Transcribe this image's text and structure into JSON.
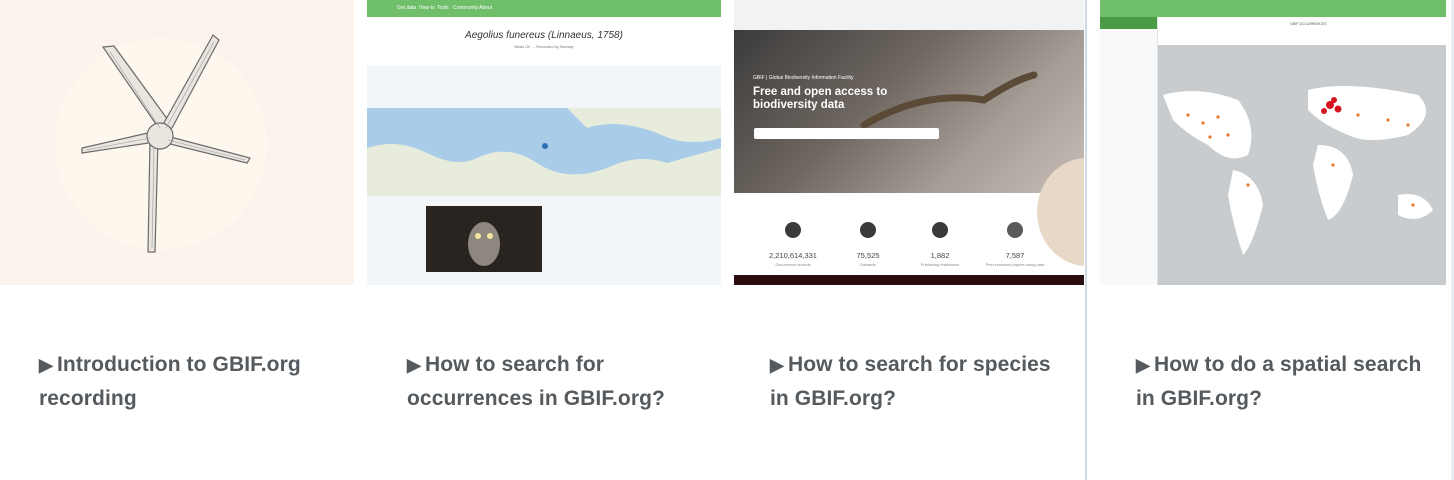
{
  "cards": [
    {
      "title": "Introduction to GBIF.org recording",
      "icon": "play-icon"
    },
    {
      "title": "How to search for occurrences in GBIF.org?",
      "icon": "play-icon"
    },
    {
      "title": "How to search for species in GBIF.org?",
      "icon": "play-icon"
    },
    {
      "title": "How to do a spatial search in GBIF.org?",
      "icon": "play-icon"
    }
  ],
  "thumb2": {
    "nav": [
      "Get data",
      "How-to",
      "Tools",
      "Community",
      "About"
    ],
    "species": "Aegolius funereus (Linnaeus, 1758)",
    "lines": [
      "Basis Of: ... Recorded by Norway"
    ]
  },
  "thumb3": {
    "hero_small": "GBIF | Global Biodiversity Information Facility",
    "hero_title": "Free and open access to biodiversity data",
    "stats": [
      {
        "value": "2,210,614,331",
        "label": "Occurrence records"
      },
      {
        "value": "75,525",
        "label": "Datasets"
      },
      {
        "value": "1,882",
        "label": "Publishing institutions"
      },
      {
        "value": "7,587",
        "label": "Peer-reviewed papers using data"
      }
    ]
  },
  "thumb4": {
    "header": "GBIF OCCURRENCES"
  },
  "colors": {
    "caption": "#555a5e",
    "gbif_green": "#6fbf6a",
    "divider": "#cfd9e3"
  }
}
